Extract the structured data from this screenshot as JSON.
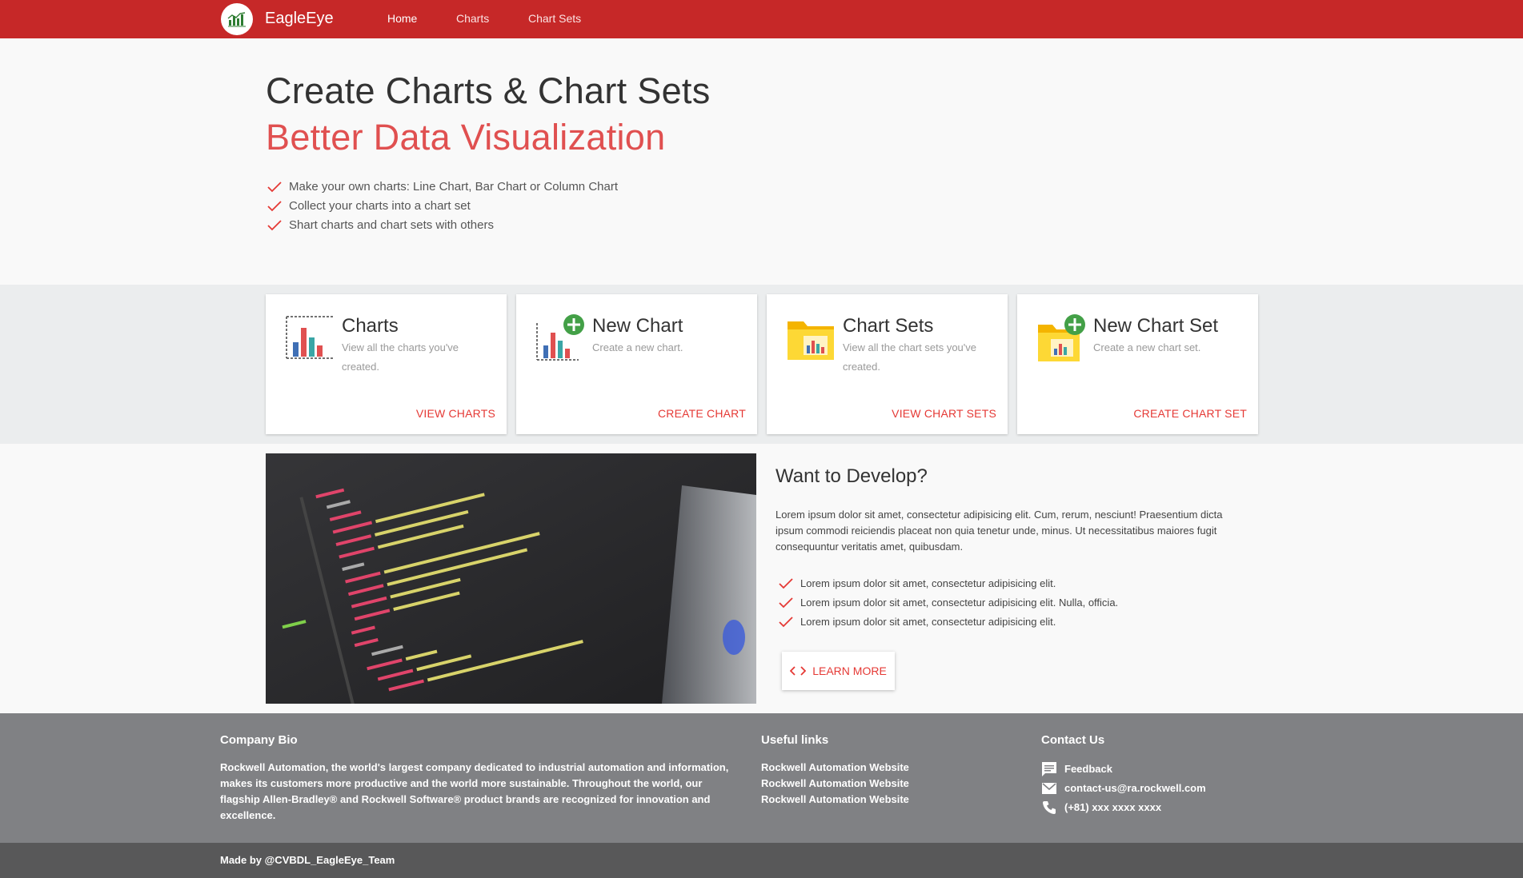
{
  "nav": {
    "brand": "EagleEye",
    "links": [
      "Home",
      "Charts",
      "Chart Sets"
    ]
  },
  "hero": {
    "title": "Create Charts & Chart Sets",
    "subtitle": "Better Data Visualization",
    "features": [
      "Make your own charts: Line Chart, Bar Chart or Column Chart",
      "Collect your charts into a chart set",
      "Shart charts and chart sets with others"
    ]
  },
  "cards": [
    {
      "title": "Charts",
      "desc": "View all the charts you've created.",
      "action": "VIEW CHARTS",
      "icon": "bar-chart-icon"
    },
    {
      "title": "New Chart",
      "desc": "Create a new chart.",
      "action": "CREATE CHART",
      "icon": "new-chart-icon"
    },
    {
      "title": "Chart Sets",
      "desc": "View all the chart sets you've created.",
      "action": "VIEW CHART SETS",
      "icon": "chart-folder-icon"
    },
    {
      "title": "New Chart Set",
      "desc": "Create a new chart set.",
      "action": "CREATE CHART SET",
      "icon": "new-chart-folder-icon"
    }
  ],
  "develop": {
    "title": "Want to Develop?",
    "text": "Lorem ipsum dolor sit amet, consectetur adipisicing elit. Cum, rerum, nesciunt! Praesentium dicta ipsum commodi reiciendis placeat non quia tenetur unde, minus. Ut necessitatibus maiores fugit consequuntur veritatis amet, quibusdam.",
    "items": [
      "Lorem ipsum dolor sit amet, consectetur adipisicing elit.",
      "Lorem ipsum dolor sit amet, consectetur adipisicing elit. Nulla, officia.",
      "Lorem ipsum dolor sit amet, consectetur adipisicing elit."
    ],
    "button": "LEARN MORE"
  },
  "footer": {
    "bio_title": "Company Bio",
    "bio_text": "Rockwell Automation, the world's largest company dedicated to industrial automation and information, makes its customers more productive and the world more sustainable. Throughout the world, our flagship Allen-Bradley® and Rockwell Software® product brands are recognized for innovation and excellence.",
    "links_title": "Useful links",
    "links": [
      "Rockwell Automation Website",
      "Rockwell Automation Website",
      "Rockwell Automation Website"
    ],
    "contact_title": "Contact Us",
    "contact": {
      "feedback": "Feedback",
      "email": "contact-us@ra.rockwell.com",
      "phone": "(+81) xxx xxxx xxxx"
    },
    "made_by": "Made by @CVBDL_EagleEye_Team"
  },
  "colors": {
    "primary": "#c62828",
    "accent": "#e53935",
    "subtitle": "#e05050",
    "footer": "#808184",
    "bottom_bar": "#585859"
  }
}
